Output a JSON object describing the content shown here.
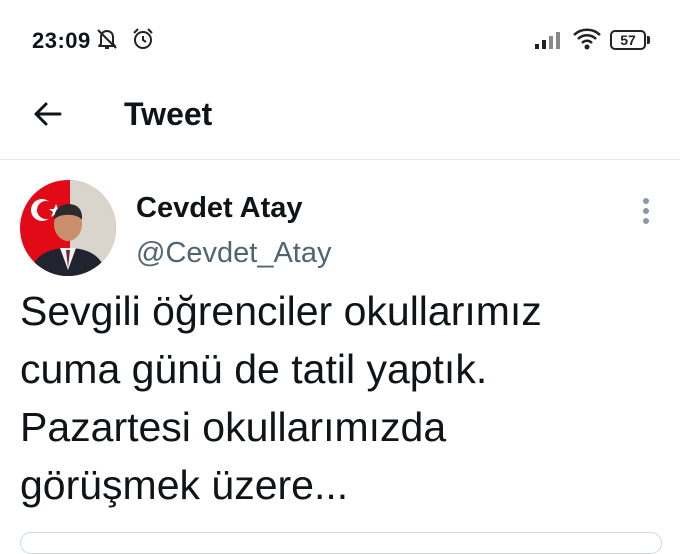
{
  "status_bar": {
    "time": "23:09",
    "battery": "57",
    "icons": [
      "bell-muted-icon",
      "alarm-clock-icon",
      "signal-bars-icon",
      "wifi-icon",
      "battery-icon"
    ]
  },
  "header": {
    "back_icon": "arrow-left-icon",
    "title": "Tweet"
  },
  "tweet": {
    "author_name": "Cevdet Atay",
    "author_handle": "@Cevdet_Atay",
    "more_icon": "more-vertical-icon",
    "text_lines": [
      "Sevgili öğrenciler okullarımız",
      "cuma günü de tatil yaptık.",
      "Pazartesi okullarımızda",
      "görüşmek üzere..."
    ]
  },
  "colors": {
    "text_primary": "#0f1419",
    "text_secondary": "#536471",
    "divider": "#e6e8ea",
    "flag_red": "#e30a17"
  }
}
